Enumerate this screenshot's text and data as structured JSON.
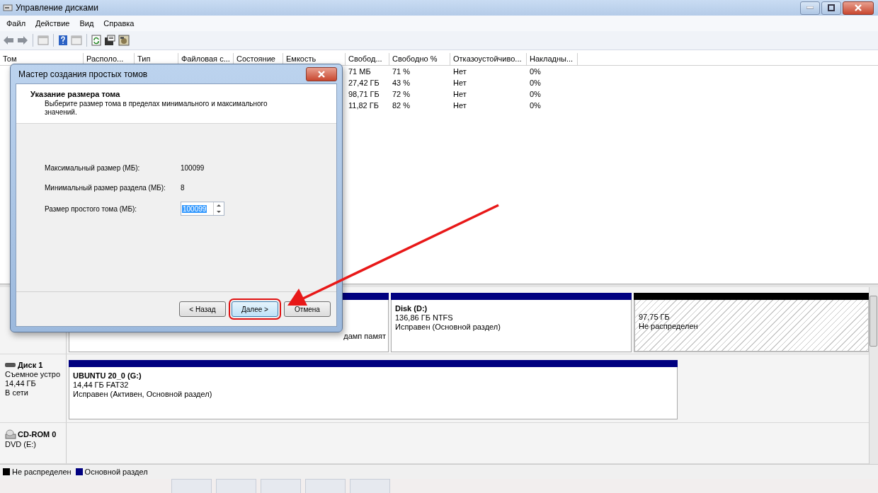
{
  "window": {
    "title": "Управление дисками"
  },
  "menu": [
    "Файл",
    "Действие",
    "Вид",
    "Справка"
  ],
  "volume_table": {
    "columns": [
      "Том",
      "Располо...",
      "Тип",
      "Файловая с...",
      "Состояние",
      "Емкость",
      "Свобод...",
      "Свободно %",
      "Отказоустойчиво...",
      "Накладны..."
    ],
    "rows": [
      {
        "cells": [
          "71 МБ",
          "71 %",
          "Нет",
          "0%"
        ]
      },
      {
        "cells": [
          "27,42 ГБ",
          "43 %",
          "Нет",
          "0%"
        ]
      },
      {
        "cells": [
          "98,71 ГБ",
          "72 %",
          "Нет",
          "0%"
        ]
      },
      {
        "cells": [
          "11,82 ГБ",
          "82 %",
          "Нет",
          "0%"
        ]
      }
    ]
  },
  "disks": [
    {
      "partitions": [
        {
          "kind": "primary",
          "status": "дамп памят"
        },
        {
          "kind": "primary",
          "title": "Disk  (D:)",
          "size": "136,86 ГБ NTFS",
          "status": "Исправен (Основной раздел)"
        },
        {
          "kind": "unallocated",
          "size": "97,75 ГБ",
          "status": "Не распределен"
        }
      ]
    },
    {
      "kind": "removable",
      "name": "Диск 1",
      "lines": [
        "Съемное устро",
        "14,44 ГБ",
        "В сети"
      ],
      "partitions": [
        {
          "kind": "primary",
          "title": "UBUNTU 20_0  (G:)",
          "size": "14,44 ГБ FAT32",
          "status": "Исправен (Активен, Основной раздел)"
        }
      ]
    },
    {
      "kind": "cdrom",
      "name": "CD-ROM 0",
      "lines": [
        "DVD (E:)"
      ]
    }
  ],
  "legend": [
    {
      "label": "Не распределен",
      "color": "#000000"
    },
    {
      "label": "Основной раздел",
      "color": "#000080"
    }
  ],
  "dialog": {
    "title": "Мастер создания простых томов",
    "heading": "Указание размера тома",
    "description": "Выберите размер тома в пределах минимального и максимального значений.",
    "fields": [
      {
        "label": "Максимальный размер (МБ):",
        "value": "100099"
      },
      {
        "label": "Минимальный размер раздела (МБ):",
        "value": "8"
      }
    ],
    "size_input": {
      "label": "Размер простого тома (МБ):",
      "value": "100099"
    },
    "buttons": [
      {
        "label": "< Назад",
        "focused": false,
        "annotated": false
      },
      {
        "label": "Далее >",
        "focused": true,
        "annotated": true
      },
      {
        "label": "Отмена",
        "focused": false,
        "annotated": false
      }
    ]
  }
}
